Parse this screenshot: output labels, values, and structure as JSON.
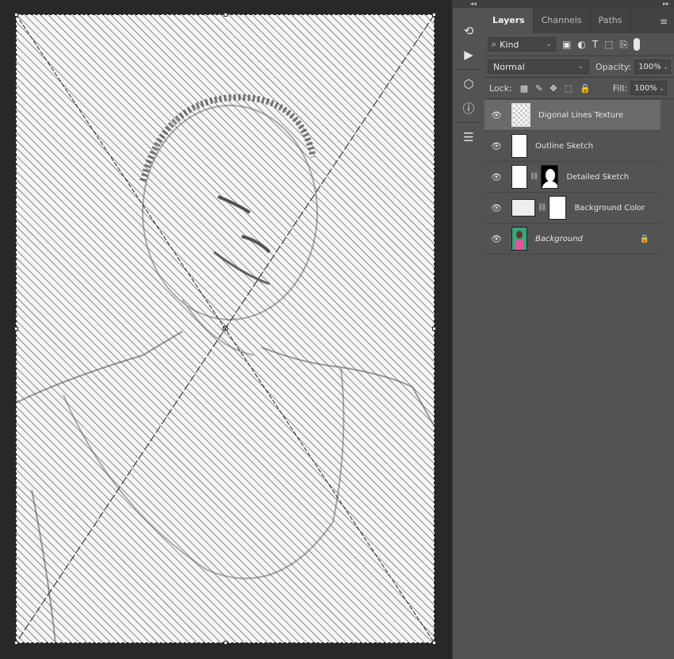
{
  "panel": {
    "tabs": [
      {
        "label": "Layers",
        "active": true
      },
      {
        "label": "Channels",
        "active": false
      },
      {
        "label": "Paths",
        "active": false
      }
    ],
    "filter": {
      "kind_label": "Kind"
    },
    "blend_mode": "Normal",
    "opacity_label": "Opacity:",
    "opacity_value": "100%",
    "lock_label": "Lock:",
    "fill_label": "Fill:",
    "fill_value": "100%"
  },
  "layers": [
    {
      "name": "Digonal Lines Texture",
      "selected": true,
      "italic": false,
      "has_mask": false,
      "locked": false
    },
    {
      "name": "Outline Sketch",
      "selected": false,
      "italic": false,
      "has_mask": false,
      "locked": false
    },
    {
      "name": "Detailed Sketch",
      "selected": false,
      "italic": false,
      "has_mask": true,
      "locked": false
    },
    {
      "name": "Background Color",
      "selected": false,
      "italic": false,
      "has_mask": true,
      "locked": false
    },
    {
      "name": "Background",
      "selected": false,
      "italic": true,
      "has_mask": false,
      "locked": true
    }
  ],
  "icons": {
    "iconbar": [
      "history-icon",
      "play-actions-icon",
      "3d-cube-icon",
      "info-icon",
      "properties-icon"
    ],
    "filters": [
      "image-filter-icon",
      "adjustment-filter-icon",
      "type-filter-icon",
      "shape-filter-icon",
      "smart-object-filter-icon"
    ],
    "locks": [
      "lock-transparent-icon",
      "lock-image-icon",
      "lock-position-icon",
      "lock-artboard-icon",
      "lock-all-icon"
    ]
  },
  "colors": {
    "panel_bg": "#535353",
    "selected_row": "#6a6a6a",
    "canvas_bg": "#282828"
  }
}
